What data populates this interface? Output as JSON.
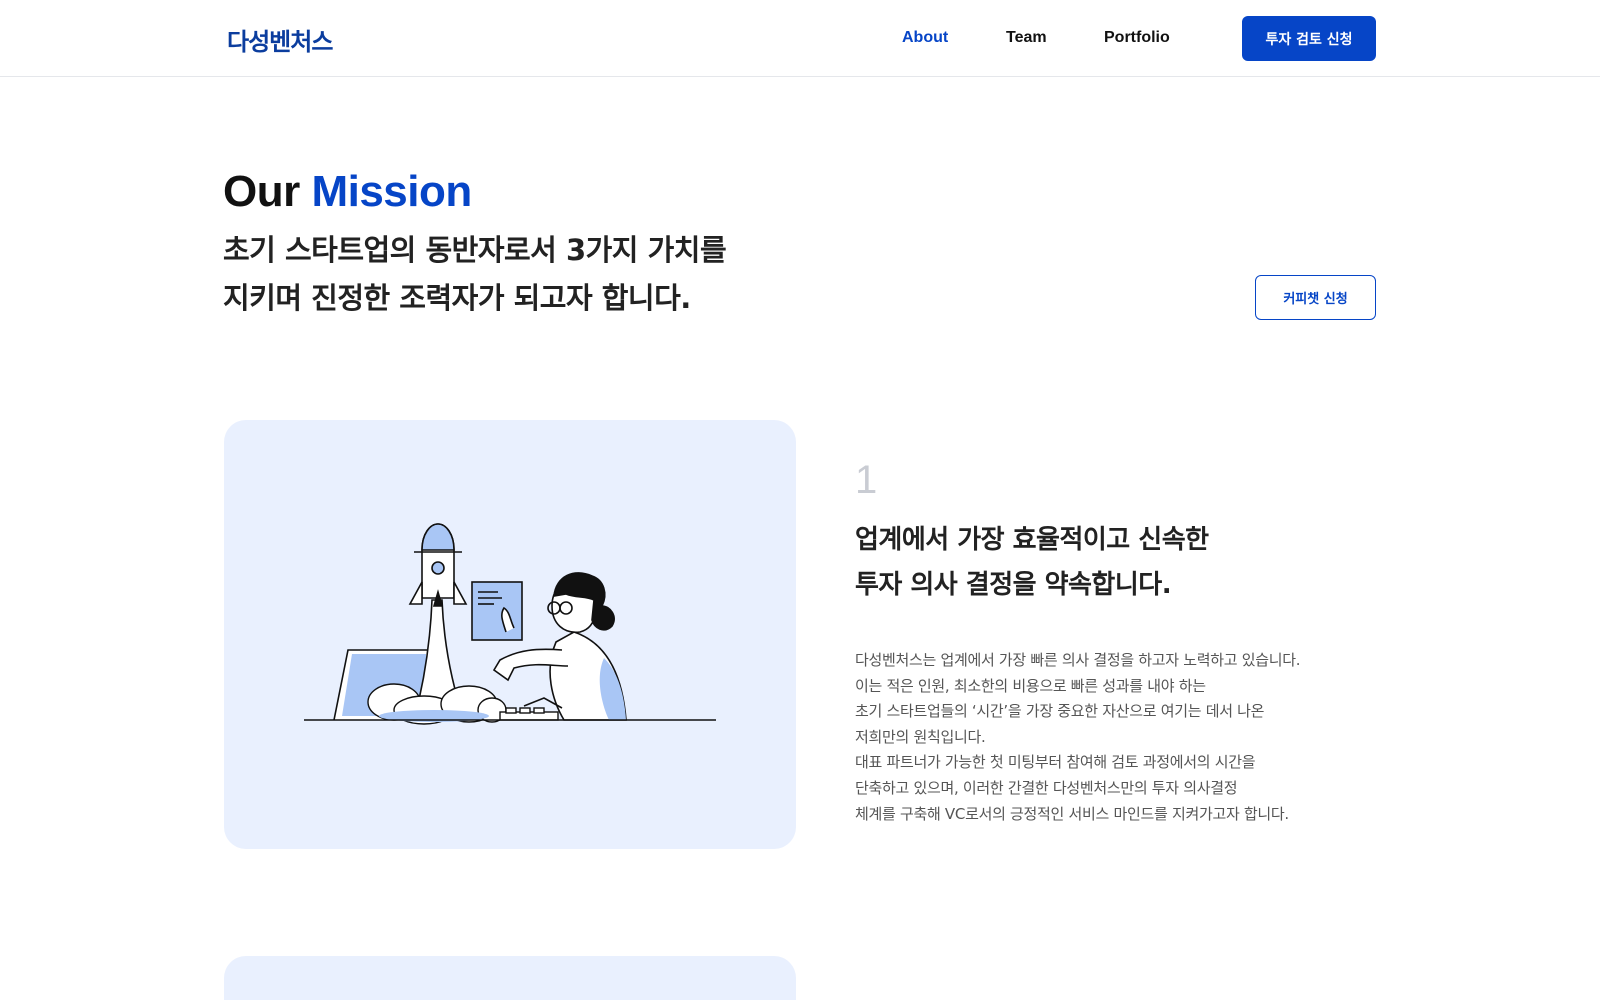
{
  "header": {
    "logo": "다성벤처스",
    "nav": [
      {
        "label": "About",
        "active": true
      },
      {
        "label": "Team",
        "active": false
      },
      {
        "label": "Portfolio",
        "active": false
      }
    ],
    "cta": "투자 검토 신청"
  },
  "hero": {
    "title_plain": "Our ",
    "title_accent": "Mission",
    "subtitle_line1": "초기 스타트업의 동반자로서 3가지 가치를",
    "subtitle_line2": "지키며 진정한 조력자가 되고자 합니다.",
    "coffee_chat": "커피챗 신청"
  },
  "feature": {
    "number": "1",
    "title_line1": "업계에서 가장 효율적이고 신속한",
    "title_line2": "투자 의사 결정을 약속합니다.",
    "body": [
      "다성벤처스는 업계에서 가장 빠른 의사 결정을 하고자 노력하고 있습니다.",
      "이는 적은 인원, 최소한의 비용으로 빠른 성과를 내야 하는",
      "초기 스타트업들의 ‘시간’을 가장 중요한 자산으로 여기는 데서 나온",
      "저희만의 원칙입니다.",
      "대표 파트너가 가능한 첫 미팅부터 참여해 검토 과정에서의 시간을",
      "단축하고 있으며, 이러한 간결한 다성벤처스만의 투자 의사결정",
      "체계를 구축해 VC로서의 긍정적인 서비스 마인드를 지켜가고자 합니다."
    ]
  },
  "colors": {
    "accent": "#0645c7",
    "card_bg": "#e9f0fe",
    "illus_fill": "#a9c6f5"
  }
}
